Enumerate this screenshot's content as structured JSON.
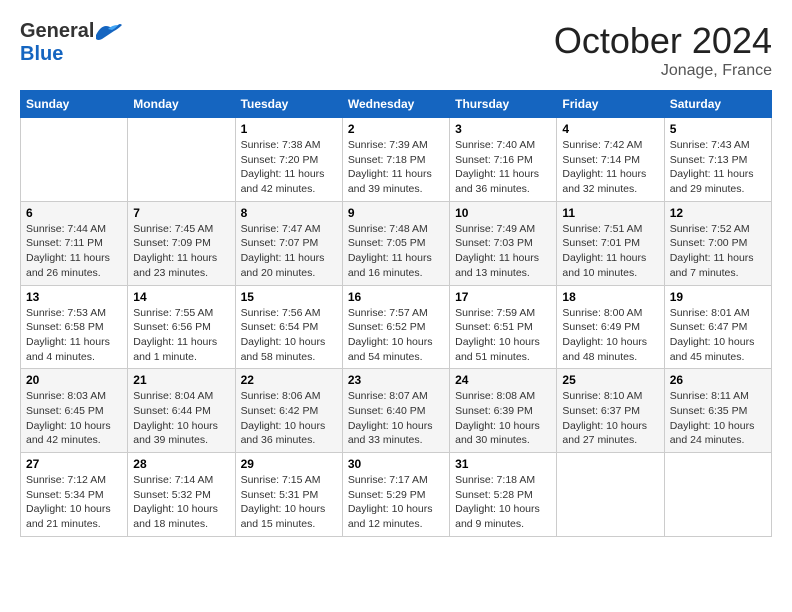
{
  "header": {
    "logo_general": "General",
    "logo_blue": "Blue",
    "month_title": "October 2024",
    "location": "Jonage, France"
  },
  "weekdays": [
    "Sunday",
    "Monday",
    "Tuesday",
    "Wednesday",
    "Thursday",
    "Friday",
    "Saturday"
  ],
  "weeks": [
    [
      {
        "day": "",
        "info": ""
      },
      {
        "day": "",
        "info": ""
      },
      {
        "day": "1",
        "info": "Sunrise: 7:38 AM\nSunset: 7:20 PM\nDaylight: 11 hours and 42 minutes."
      },
      {
        "day": "2",
        "info": "Sunrise: 7:39 AM\nSunset: 7:18 PM\nDaylight: 11 hours and 39 minutes."
      },
      {
        "day": "3",
        "info": "Sunrise: 7:40 AM\nSunset: 7:16 PM\nDaylight: 11 hours and 36 minutes."
      },
      {
        "day": "4",
        "info": "Sunrise: 7:42 AM\nSunset: 7:14 PM\nDaylight: 11 hours and 32 minutes."
      },
      {
        "day": "5",
        "info": "Sunrise: 7:43 AM\nSunset: 7:13 PM\nDaylight: 11 hours and 29 minutes."
      }
    ],
    [
      {
        "day": "6",
        "info": "Sunrise: 7:44 AM\nSunset: 7:11 PM\nDaylight: 11 hours and 26 minutes."
      },
      {
        "day": "7",
        "info": "Sunrise: 7:45 AM\nSunset: 7:09 PM\nDaylight: 11 hours and 23 minutes."
      },
      {
        "day": "8",
        "info": "Sunrise: 7:47 AM\nSunset: 7:07 PM\nDaylight: 11 hours and 20 minutes."
      },
      {
        "day": "9",
        "info": "Sunrise: 7:48 AM\nSunset: 7:05 PM\nDaylight: 11 hours and 16 minutes."
      },
      {
        "day": "10",
        "info": "Sunrise: 7:49 AM\nSunset: 7:03 PM\nDaylight: 11 hours and 13 minutes."
      },
      {
        "day": "11",
        "info": "Sunrise: 7:51 AM\nSunset: 7:01 PM\nDaylight: 11 hours and 10 minutes."
      },
      {
        "day": "12",
        "info": "Sunrise: 7:52 AM\nSunset: 7:00 PM\nDaylight: 11 hours and 7 minutes."
      }
    ],
    [
      {
        "day": "13",
        "info": "Sunrise: 7:53 AM\nSunset: 6:58 PM\nDaylight: 11 hours and 4 minutes."
      },
      {
        "day": "14",
        "info": "Sunrise: 7:55 AM\nSunset: 6:56 PM\nDaylight: 11 hours and 1 minute."
      },
      {
        "day": "15",
        "info": "Sunrise: 7:56 AM\nSunset: 6:54 PM\nDaylight: 10 hours and 58 minutes."
      },
      {
        "day": "16",
        "info": "Sunrise: 7:57 AM\nSunset: 6:52 PM\nDaylight: 10 hours and 54 minutes."
      },
      {
        "day": "17",
        "info": "Sunrise: 7:59 AM\nSunset: 6:51 PM\nDaylight: 10 hours and 51 minutes."
      },
      {
        "day": "18",
        "info": "Sunrise: 8:00 AM\nSunset: 6:49 PM\nDaylight: 10 hours and 48 minutes."
      },
      {
        "day": "19",
        "info": "Sunrise: 8:01 AM\nSunset: 6:47 PM\nDaylight: 10 hours and 45 minutes."
      }
    ],
    [
      {
        "day": "20",
        "info": "Sunrise: 8:03 AM\nSunset: 6:45 PM\nDaylight: 10 hours and 42 minutes."
      },
      {
        "day": "21",
        "info": "Sunrise: 8:04 AM\nSunset: 6:44 PM\nDaylight: 10 hours and 39 minutes."
      },
      {
        "day": "22",
        "info": "Sunrise: 8:06 AM\nSunset: 6:42 PM\nDaylight: 10 hours and 36 minutes."
      },
      {
        "day": "23",
        "info": "Sunrise: 8:07 AM\nSunset: 6:40 PM\nDaylight: 10 hours and 33 minutes."
      },
      {
        "day": "24",
        "info": "Sunrise: 8:08 AM\nSunset: 6:39 PM\nDaylight: 10 hours and 30 minutes."
      },
      {
        "day": "25",
        "info": "Sunrise: 8:10 AM\nSunset: 6:37 PM\nDaylight: 10 hours and 27 minutes."
      },
      {
        "day": "26",
        "info": "Sunrise: 8:11 AM\nSunset: 6:35 PM\nDaylight: 10 hours and 24 minutes."
      }
    ],
    [
      {
        "day": "27",
        "info": "Sunrise: 7:12 AM\nSunset: 5:34 PM\nDaylight: 10 hours and 21 minutes."
      },
      {
        "day": "28",
        "info": "Sunrise: 7:14 AM\nSunset: 5:32 PM\nDaylight: 10 hours and 18 minutes."
      },
      {
        "day": "29",
        "info": "Sunrise: 7:15 AM\nSunset: 5:31 PM\nDaylight: 10 hours and 15 minutes."
      },
      {
        "day": "30",
        "info": "Sunrise: 7:17 AM\nSunset: 5:29 PM\nDaylight: 10 hours and 12 minutes."
      },
      {
        "day": "31",
        "info": "Sunrise: 7:18 AM\nSunset: 5:28 PM\nDaylight: 10 hours and 9 minutes."
      },
      {
        "day": "",
        "info": ""
      },
      {
        "day": "",
        "info": ""
      }
    ]
  ]
}
